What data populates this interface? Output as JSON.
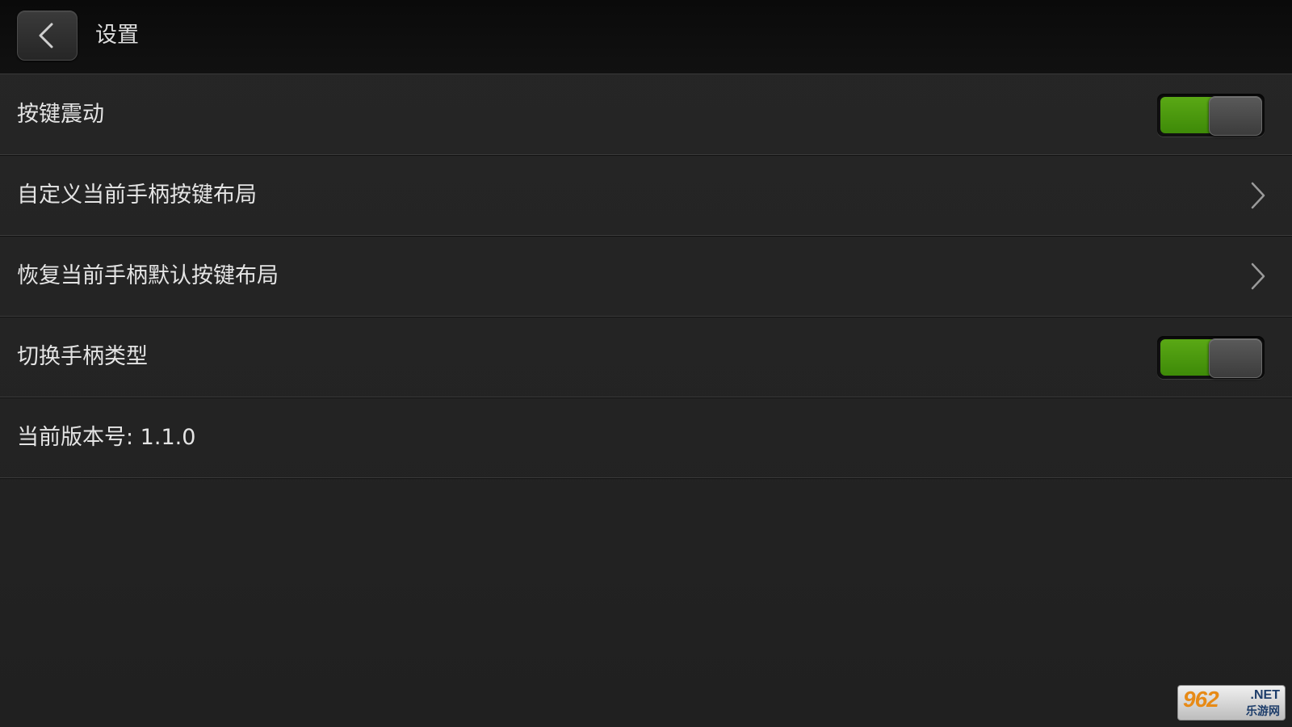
{
  "header": {
    "title": "设置"
  },
  "settings": [
    {
      "label": "按键震动",
      "control": "toggle",
      "on": true
    },
    {
      "label": "自定义当前手柄按键布局",
      "control": "chevron"
    },
    {
      "label": "恢复当前手柄默认按键布局",
      "control": "chevron"
    },
    {
      "label": "切换手柄类型",
      "control": "toggle",
      "on": true
    },
    {
      "label": "当前版本号: 1.1.0",
      "control": "none"
    }
  ],
  "watermark": {
    "number": "962",
    "suffix": ".NET",
    "cn": "乐游网"
  },
  "colors": {
    "toggle_on": "#4c9a0e",
    "background": "#232323",
    "titlebar": "#0e0e0e"
  },
  "icons": {
    "back": "chevron-left-icon",
    "row_arrow": "chevron-right-icon"
  }
}
